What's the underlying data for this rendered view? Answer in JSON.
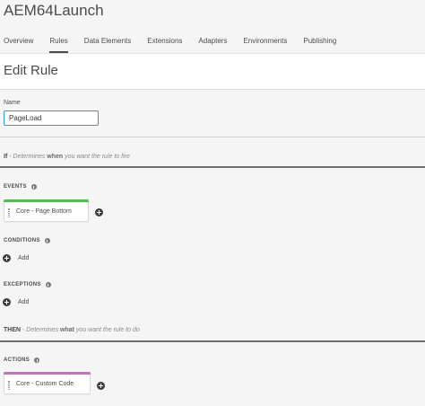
{
  "app": {
    "title": "AEM64Launch"
  },
  "tabs": [
    {
      "label": "Overview",
      "active": false
    },
    {
      "label": "Rules",
      "active": true
    },
    {
      "label": "Data Elements",
      "active": false
    },
    {
      "label": "Extensions",
      "active": false
    },
    {
      "label": "Adapters",
      "active": false
    },
    {
      "label": "Environments",
      "active": false
    },
    {
      "label": "Publishing",
      "active": false
    }
  ],
  "page": {
    "title": "Edit Rule"
  },
  "name_field": {
    "label": "Name",
    "value": "PageLoad"
  },
  "if_section": {
    "keyword": "If",
    "pre": " - Determines ",
    "emph": "when",
    "post": " you want the rule to fire"
  },
  "events": {
    "label": "EVENTS",
    "items": [
      {
        "label": "Core - Page Bottom",
        "color": "#5bb75b"
      }
    ]
  },
  "conditions": {
    "label": "CONDITIONS",
    "add_label": "Add"
  },
  "exceptions": {
    "label": "EXCEPTIONS",
    "add_label": "Add"
  },
  "then_section": {
    "keyword": "THEN",
    "pre": " - Determines ",
    "emph": "what",
    "post": " you want the rule to do"
  },
  "actions": {
    "label": "ACTIONS",
    "items": [
      {
        "label": "Core - Custom Code",
        "color": "#b57ab5"
      }
    ]
  },
  "colors": {
    "input_focus": "#2d9dd7",
    "event_bar": "#5bb75b",
    "action_bar": "#b57ab5"
  },
  "icons": [
    "info-icon",
    "add-circle-icon",
    "drag-handle-icon"
  ]
}
